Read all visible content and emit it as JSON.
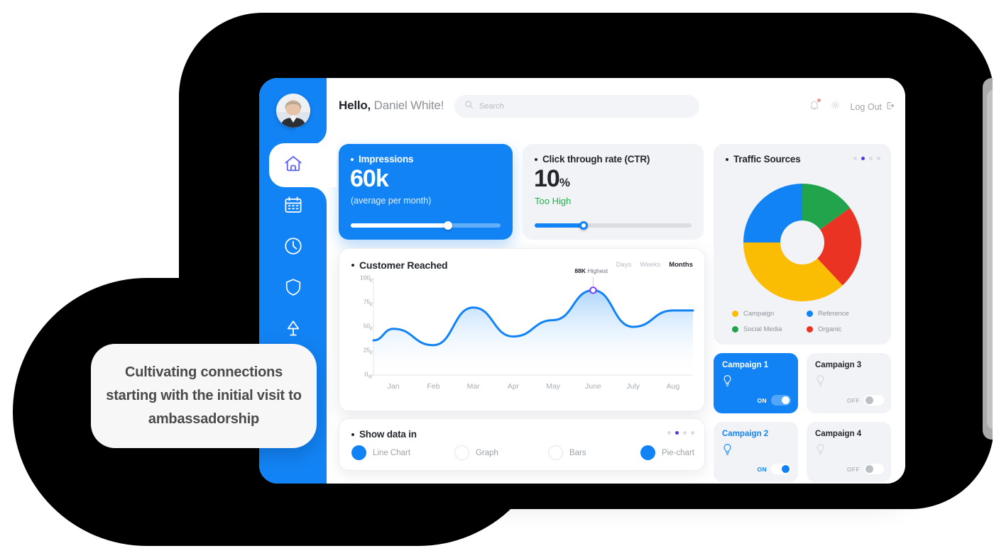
{
  "header": {
    "greeting_bold": "Hello,",
    "greeting_name": "Daniel White!",
    "search_placeholder": "Search",
    "logout_label": "Log Out",
    "avatar_name": "user-avatar"
  },
  "sidebar": {
    "items": [
      {
        "icon": "home-icon",
        "active": true
      },
      {
        "icon": "calendar-icon",
        "active": false
      },
      {
        "icon": "clock-icon",
        "active": false
      },
      {
        "icon": "shield-icon",
        "active": false
      },
      {
        "icon": "lamp-icon",
        "active": false
      }
    ]
  },
  "impressions": {
    "title": "Impressions",
    "value": "60k",
    "caption": "(average per month)",
    "slider_percent": 65
  },
  "ctr": {
    "title": "Click through rate (CTR)",
    "value": "10",
    "suffix": "%",
    "status": "Too High",
    "status_color": "#22b04f",
    "slider_percent": 31
  },
  "customer_reached": {
    "title": "Customer Reached",
    "tabs": [
      {
        "label": "Days",
        "active": false
      },
      {
        "label": "Weeks",
        "active": false
      },
      {
        "label": "Months",
        "active": true
      }
    ],
    "peak_value": "88K",
    "peak_label": "Highest"
  },
  "show_data_in": {
    "title": "Show data in",
    "options": [
      {
        "label": "Line Chart",
        "selected": true
      },
      {
        "label": "Graph",
        "selected": false
      },
      {
        "label": "Bars",
        "selected": false
      },
      {
        "label": "Pie-chart",
        "selected": true
      }
    ],
    "dots": [
      false,
      true,
      false,
      false
    ]
  },
  "traffic_sources": {
    "title": "Traffic Sources",
    "dots": [
      false,
      true,
      false,
      false
    ],
    "legend": [
      {
        "label": "Campaign",
        "color": "#fbbc04"
      },
      {
        "label": "Reference",
        "color": "#1283f5"
      },
      {
        "label": "Social Media",
        "color": "#21a44c"
      },
      {
        "label": "Organic",
        "color": "#ea3323"
      }
    ]
  },
  "campaigns": [
    {
      "name": "Campaign 1",
      "state": "ON"
    },
    {
      "name": "Campaign 3",
      "state": "OFF"
    },
    {
      "name": "Campaign 2",
      "state": "ON"
    },
    {
      "name": "Campaign 4",
      "state": "OFF"
    }
  ],
  "callout": {
    "text": "Cultivating connections starting with the initial visit to ambassadorship"
  },
  "chart_data": [
    {
      "type": "area",
      "title": "Customer Reached",
      "xlabel": "",
      "ylabel": "",
      "categories": [
        "Jan",
        "Feb",
        "Mar",
        "Apr",
        "May",
        "June",
        "July",
        "Aug"
      ],
      "x_extra_start": 36,
      "values": [
        48,
        31,
        70,
        40,
        57,
        88,
        50,
        67
      ],
      "ylim": [
        0,
        100
      ],
      "ytick_labels": [
        "0%",
        "25к",
        "50к",
        "75к",
        "100к"
      ],
      "yticks": [
        0,
        25,
        50,
        75,
        100
      ],
      "unit": "K",
      "grid": false,
      "line_color": "#1283f5",
      "annotation": {
        "text": "88K Highest",
        "x": "June",
        "y": 88
      },
      "legend": "none"
    },
    {
      "type": "pie",
      "title": "Traffic Sources",
      "variant": "donut",
      "labels": [
        "Social Media",
        "Organic",
        "Campaign",
        "Reference"
      ],
      "values": [
        15,
        23,
        37,
        25
      ],
      "colors": [
        "#21a44c",
        "#ea3323",
        "#fbbc04",
        "#1283f5"
      ],
      "legend": "bottom"
    }
  ]
}
